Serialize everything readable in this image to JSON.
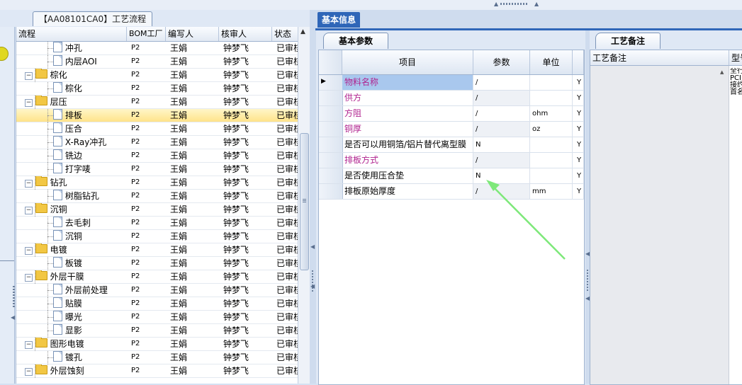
{
  "left_panel": {
    "tab_title": "【AA08101CA0】工艺流程",
    "columns": [
      "流程",
      "BOM工厂",
      "编写人",
      "核审人",
      "状态"
    ],
    "rows": [
      {
        "name": "冲孔",
        "type": "doc",
        "level": 2,
        "factory": "P2",
        "writer": "王娟",
        "reviewer": "钟梦飞",
        "status": "已审核"
      },
      {
        "name": "内层AOI",
        "type": "doc",
        "level": 2,
        "factory": "P2",
        "writer": "王娟",
        "reviewer": "钟梦飞",
        "status": "已审核"
      },
      {
        "name": "棕化",
        "type": "folder",
        "level": 1,
        "factory": "P2",
        "writer": "王娟",
        "reviewer": "钟梦飞",
        "status": "已审核"
      },
      {
        "name": "棕化",
        "type": "doc",
        "level": 2,
        "factory": "P2",
        "writer": "王娟",
        "reviewer": "钟梦飞",
        "status": "已审核"
      },
      {
        "name": "层压",
        "type": "folder",
        "level": 1,
        "factory": "P2",
        "writer": "王娟",
        "reviewer": "钟梦飞",
        "status": "已审核"
      },
      {
        "name": "排板",
        "type": "doc",
        "level": 2,
        "factory": "P2",
        "writer": "王娟",
        "reviewer": "钟梦飞",
        "status": "已审核",
        "selected": true
      },
      {
        "name": "压合",
        "type": "doc",
        "level": 2,
        "factory": "P2",
        "writer": "王娟",
        "reviewer": "钟梦飞",
        "status": "已审核"
      },
      {
        "name": "X-Ray冲孔",
        "type": "doc",
        "level": 2,
        "factory": "P2",
        "writer": "王娟",
        "reviewer": "钟梦飞",
        "status": "已审核"
      },
      {
        "name": "铣边",
        "type": "doc",
        "level": 2,
        "factory": "P2",
        "writer": "王娟",
        "reviewer": "钟梦飞",
        "status": "已审核"
      },
      {
        "name": "打字唛",
        "type": "doc",
        "level": 2,
        "factory": "P2",
        "writer": "王娟",
        "reviewer": "钟梦飞",
        "status": "已审核"
      },
      {
        "name": "钻孔",
        "type": "folder",
        "level": 1,
        "factory": "P2",
        "writer": "王娟",
        "reviewer": "钟梦飞",
        "status": "已审核"
      },
      {
        "name": "树脂钻孔",
        "type": "doc",
        "level": 2,
        "factory": "P2",
        "writer": "王娟",
        "reviewer": "钟梦飞",
        "status": "已审核"
      },
      {
        "name": "沉铜",
        "type": "folder",
        "level": 1,
        "factory": "P2",
        "writer": "王娟",
        "reviewer": "钟梦飞",
        "status": "已审核"
      },
      {
        "name": "去毛刺",
        "type": "doc",
        "level": 2,
        "factory": "P2",
        "writer": "王娟",
        "reviewer": "钟梦飞",
        "status": "已审核"
      },
      {
        "name": "沉铜",
        "type": "doc",
        "level": 2,
        "factory": "P2",
        "writer": "王娟",
        "reviewer": "钟梦飞",
        "status": "已审核"
      },
      {
        "name": "电镀",
        "type": "folder",
        "level": 1,
        "factory": "P2",
        "writer": "王娟",
        "reviewer": "钟梦飞",
        "status": "已审核"
      },
      {
        "name": "板镀",
        "type": "doc",
        "level": 2,
        "factory": "P2",
        "writer": "王娟",
        "reviewer": "钟梦飞",
        "status": "已审核"
      },
      {
        "name": "外层干膜",
        "type": "folder",
        "level": 1,
        "factory": "P2",
        "writer": "王娟",
        "reviewer": "钟梦飞",
        "status": "已审核"
      },
      {
        "name": "外层前处理",
        "type": "doc",
        "level": 2,
        "factory": "P2",
        "writer": "王娟",
        "reviewer": "钟梦飞",
        "status": "已审核"
      },
      {
        "name": "贴膜",
        "type": "doc",
        "level": 2,
        "factory": "P2",
        "writer": "王娟",
        "reviewer": "钟梦飞",
        "status": "已审核"
      },
      {
        "name": "曝光",
        "type": "doc",
        "level": 2,
        "factory": "P2",
        "writer": "王娟",
        "reviewer": "钟梦飞",
        "status": "已审核"
      },
      {
        "name": "显影",
        "type": "doc",
        "level": 2,
        "factory": "P2",
        "writer": "王娟",
        "reviewer": "钟梦飞",
        "status": "已审核"
      },
      {
        "name": "图形电镀",
        "type": "folder",
        "level": 1,
        "factory": "P2",
        "writer": "王娟",
        "reviewer": "钟梦飞",
        "status": "已审核"
      },
      {
        "name": "镀孔",
        "type": "doc",
        "level": 2,
        "factory": "P2",
        "writer": "王娟",
        "reviewer": "钟梦飞",
        "status": "已审核"
      },
      {
        "name": "外层蚀刻",
        "type": "folder",
        "level": 1,
        "factory": "P2",
        "writer": "王娟",
        "reviewer": "钟梦飞",
        "status": "已审核"
      }
    ]
  },
  "main_tab": "基本信息",
  "basic": {
    "tab": "基本参数",
    "columns": [
      "项目",
      "参数",
      "单位"
    ],
    "rows": [
      {
        "item": "物料名称",
        "param": "/",
        "unit": "",
        "flag": "Y",
        "highlight": true,
        "first": true
      },
      {
        "item": "供方",
        "param": "/",
        "unit": "",
        "flag": "Y",
        "highlight": true
      },
      {
        "item": "方阻",
        "param": "/",
        "unit": "ohm",
        "flag": "Y",
        "highlight": true
      },
      {
        "item": "铜厚",
        "param": "/",
        "unit": "oz",
        "flag": "Y",
        "highlight": true
      },
      {
        "item": "是否可以用铜箔/铝片替代离型膜",
        "param": "N",
        "unit": "",
        "flag": "Y",
        "highlight": false
      },
      {
        "item": "排板方式",
        "param": "/",
        "unit": "",
        "flag": "Y",
        "highlight": true
      },
      {
        "item": "是否使用压合垫",
        "param": "N",
        "unit": "",
        "flag": "Y",
        "highlight": false
      },
      {
        "item": "排板原始厚度",
        "param": "/",
        "unit": "mm",
        "flag": "Y",
        "highlight": false
      }
    ]
  },
  "remark": {
    "tab": "工艺备注",
    "col1": "工艺备注",
    "col2": "型号",
    "snippet": [
      "全行",
      "PCI",
      "接约",
      "首名"
    ]
  },
  "colors": {
    "accent": "#2f66b8",
    "highlight_text": "#b0238f",
    "annotation_arrow": "#7ee87a"
  }
}
